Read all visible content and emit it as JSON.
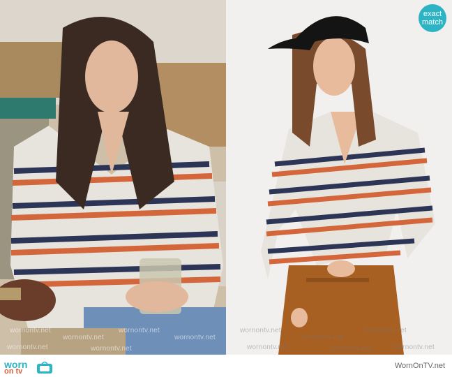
{
  "badge": {
    "line1": "exact",
    "line2": "match"
  },
  "watermark_text": "wornontv.net",
  "footer": {
    "logo_line1": "worn",
    "logo_line2": "on tv",
    "site": "WornOnTV.net"
  },
  "colors": {
    "accent": "#2cb4c4",
    "sweater_base": "#e7e4de",
    "stripe_navy": "#2c3555",
    "stripe_rust": "#d4663c",
    "pants": "#a85f22"
  }
}
